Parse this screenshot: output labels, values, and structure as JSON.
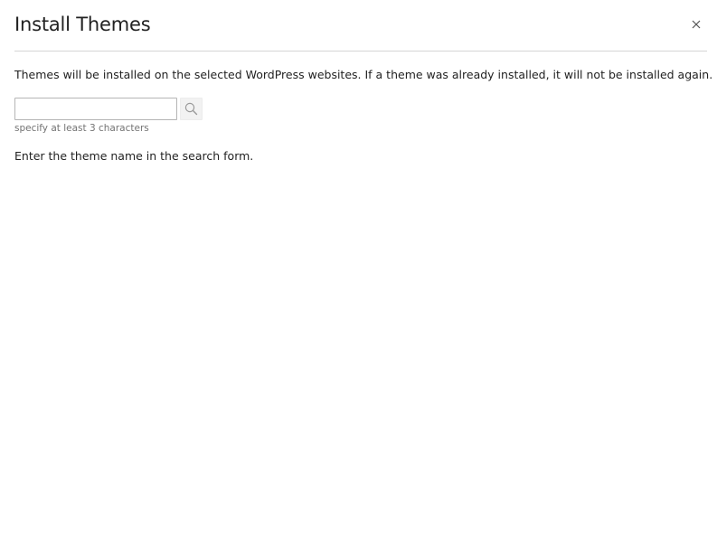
{
  "dialog": {
    "title": "Install Themes",
    "close_icon": "close-icon"
  },
  "description": "Themes will be installed on the selected WordPress websites. If a theme was already installed, it will not be installed again.",
  "search": {
    "value": "",
    "placeholder": "",
    "button_icon": "search-icon",
    "hint": "specify at least 3 characters"
  },
  "empty_message": "Enter the theme name in the search form.",
  "colors": {
    "text": "#222222",
    "hint": "#737373",
    "divider": "#d6d6d6",
    "input_border": "#b5b5b5",
    "button_bg": "#f2f2f2"
  }
}
